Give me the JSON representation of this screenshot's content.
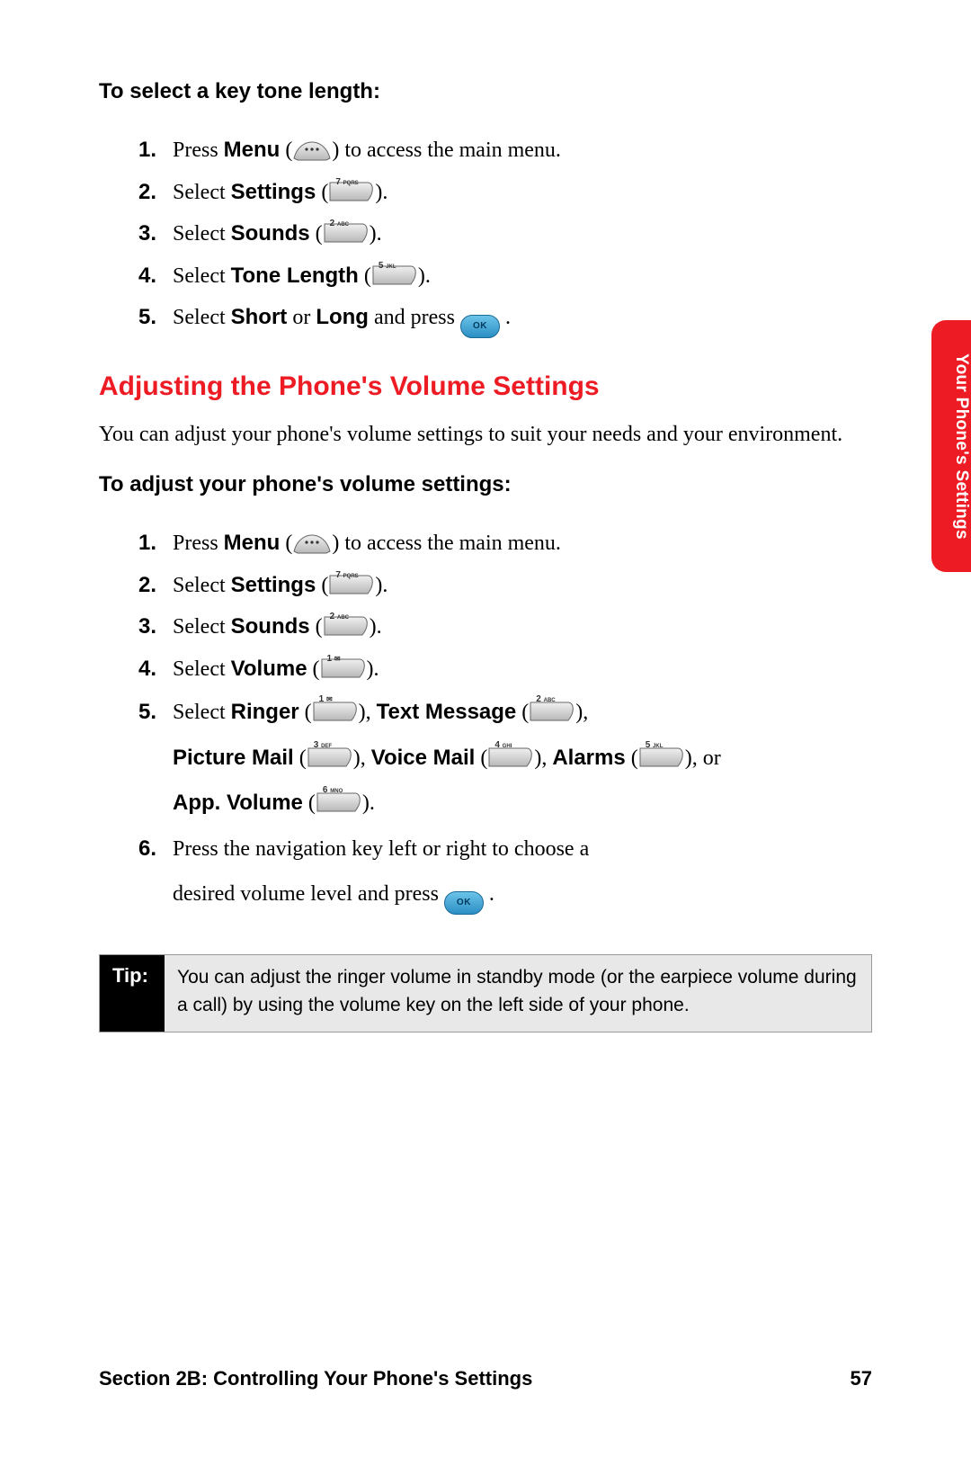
{
  "section1": {
    "subhead": "To select a key tone length:",
    "steps": {
      "s1": {
        "num": "1.",
        "pre": "Press ",
        "bold": "Menu",
        "post": " to access the main menu."
      },
      "s2": {
        "num": "2.",
        "pre": "Select ",
        "bold": "Settings",
        "post": "."
      },
      "s3": {
        "num": "3.",
        "pre": "Select ",
        "bold": "Sounds",
        "post": "."
      },
      "s4": {
        "num": "4.",
        "pre": "Select ",
        "bold": "Tone Length",
        "post": "."
      },
      "s5": {
        "num": "5.",
        "pre": "Select ",
        "bold1": "Short",
        "mid": " or ",
        "bold2": "Long",
        "post1": " and press ",
        "post2": " ."
      }
    }
  },
  "title": "Adjusting the Phone's Volume Settings",
  "intro": "You can adjust your phone's volume settings to suit your needs and your environment.",
  "section2": {
    "subhead": "To adjust your phone's volume settings:",
    "steps": {
      "s1": {
        "num": "1.",
        "pre": "Press ",
        "bold": "Menu",
        "post": " to access the main menu."
      },
      "s2": {
        "num": "2.",
        "pre": "Select ",
        "bold": "Settings",
        "post": "."
      },
      "s3": {
        "num": "3.",
        "pre": "Select ",
        "bold": "Sounds",
        "post": "."
      },
      "s4": {
        "num": "4.",
        "pre": "Select ",
        "bold": "Volume",
        "post": "."
      },
      "s5": {
        "num": "5.",
        "pre": "Select ",
        "b1": "Ringer",
        "c1": ", ",
        "b2": "Text Message",
        "c2": ",",
        "b3": "Picture Mail",
        "c3": ", ",
        "b4": "Voice Mail",
        "c4": ", ",
        "b5": "Alarms",
        "c5": ", or",
        "b6": "App. Volume",
        "post": "."
      },
      "s6": {
        "num": "6.",
        "text1": "Press the navigation key left or right to choose a",
        "text2": "desired volume level and press ",
        "post": " ."
      }
    }
  },
  "keys": {
    "k1": "1",
    "k1s": "✉",
    "k2": "2",
    "k2s": "ABC",
    "k3": "3",
    "k3s": "DEF",
    "k4": "4",
    "k4s": "GHI",
    "k5": "5",
    "k5s": "JKL",
    "k6": "6",
    "k6s": "MNO",
    "k7": "7",
    "k7s": "PQRS",
    "ok": "OK"
  },
  "sidetab": "Your Phone's Settings",
  "tip": {
    "label": "Tip:",
    "body": "You can adjust the ringer volume in standby mode (or the earpiece volume during a call) by using the volume key on the left side of your phone."
  },
  "footer": {
    "left": "Section 2B: Controlling Your Phone's Settings",
    "right": "57"
  }
}
